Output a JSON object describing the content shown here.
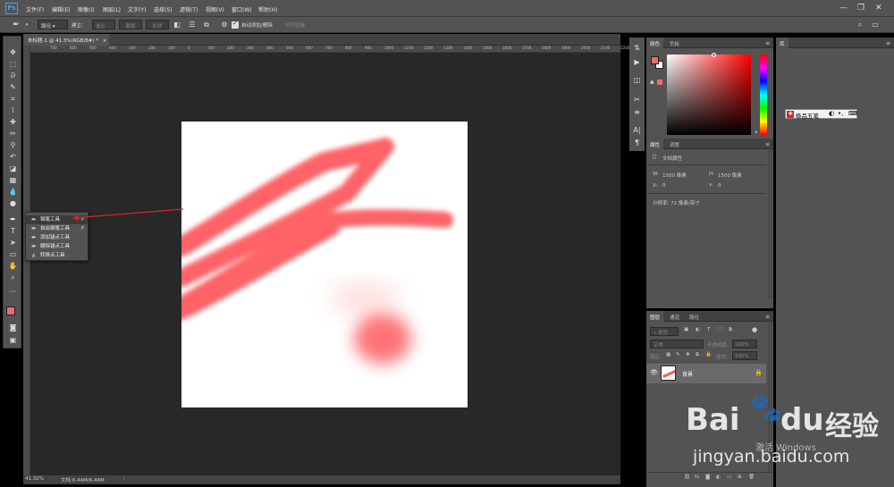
{
  "app": {
    "logo": "Ps",
    "accent": "#31a8ff"
  },
  "menu": [
    "文件(F)",
    "编辑(E)",
    "图像(I)",
    "图层(L)",
    "文字(Y)",
    "选择(S)",
    "滤镜(T)",
    "视图(V)",
    "窗口(W)",
    "帮助(H)"
  ],
  "window_controls": {
    "minimize": "—",
    "restore": "❐",
    "close": "✕"
  },
  "options_bar": {
    "tool_mode": "路径",
    "create_label": "建立：",
    "selection_btn": "选区...",
    "mask_btn": "蒙版",
    "shape_btn": "形状",
    "auto_add_delete": "自动添加/删除",
    "align_edges": "对齐边缘"
  },
  "document": {
    "tab_title": "未标题-1 @ 41.3%(RGB/8#) *",
    "zoom": "41.32%",
    "doc_info": "文档:6.44M/6.44M",
    "ruler_marks": [
      "700",
      "600",
      "500",
      "400",
      "300",
      "200",
      "100",
      "0",
      "100",
      "200",
      "300",
      "400",
      "500",
      "600",
      "700",
      "800",
      "900",
      "1000",
      "1100",
      "1200",
      "1300",
      "1400",
      "1500",
      "1600",
      "1700",
      "1800",
      "1900",
      "2000",
      "2100",
      "2200"
    ]
  },
  "flyout": {
    "items": [
      {
        "label": "钢笔工具",
        "key": "P",
        "icon": "pen-icon"
      },
      {
        "label": "自由钢笔工具",
        "key": "P",
        "icon": "freeform-pen-icon"
      },
      {
        "label": "添加锚点工具",
        "key": "",
        "icon": "add-anchor-icon"
      },
      {
        "label": "删除锚点工具",
        "key": "",
        "icon": "delete-anchor-icon"
      },
      {
        "label": "转换点工具",
        "key": "",
        "icon": "convert-point-icon"
      }
    ]
  },
  "color_panel": {
    "tabs": [
      "颜色",
      "色板"
    ],
    "foreground": "#f26b6b",
    "background": "#ffffff"
  },
  "properties_panel": {
    "tabs": [
      "属性",
      "调整"
    ],
    "section_title": "文档属性",
    "w_label": "W:",
    "w_value": "1500 像素",
    "h_label": "H:",
    "h_value": "1500 像素",
    "x_label": "X:",
    "x_value": "0",
    "y_label": "Y:",
    "y_value": "0",
    "resolution": "分辨率: 72 像素/英寸"
  },
  "layers_panel": {
    "tabs": [
      "图层",
      "通道",
      "路径"
    ],
    "filter_placeholder": "类型",
    "blend_mode": "正常",
    "opacity_label": "不透明度:",
    "opacity_value": "100%",
    "lock_label": "锁定:",
    "fill_label": "填充:",
    "fill_value": "100%",
    "layers": [
      {
        "name": "背景"
      }
    ]
  },
  "library_panel": {
    "tabs": [
      "库"
    ],
    "ime_label": "极品五笔"
  },
  "watermark": {
    "brand_a": "Bai",
    "brand_b": "du",
    "brand_cn": "经验",
    "activate": "激活 Windows",
    "url": "jingyan.baidu.com"
  },
  "stroke_color": "#ff5a5f"
}
